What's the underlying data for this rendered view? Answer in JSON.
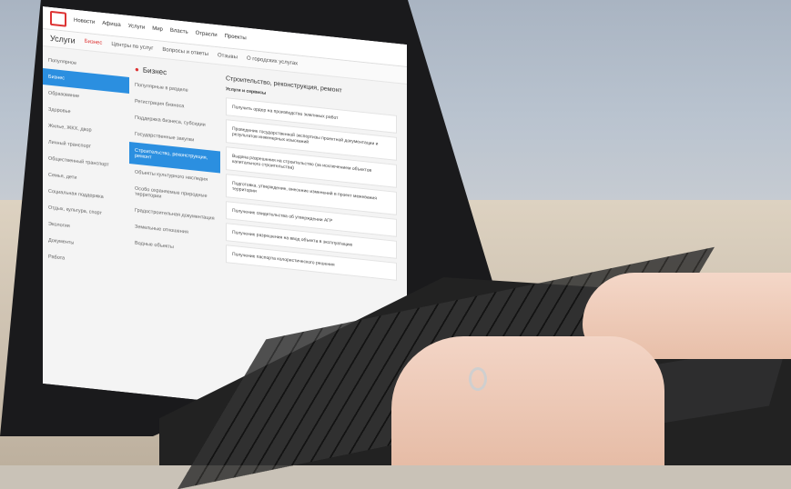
{
  "screen": {
    "topnav": [
      "Новости",
      "Афиша",
      "Услуги",
      "Мир",
      "Власть",
      "Отрасли",
      "Проекты"
    ],
    "subnav": {
      "title": "Услуги",
      "items": [
        "Бизнес",
        "Центры по услуг",
        "Вопросы и ответы",
        "Отзывы",
        "О городских услугах"
      ]
    },
    "col1": {
      "items": [
        "Популярное",
        "Бизнес",
        "Образование",
        "Здоровье",
        "Жилье, ЖКХ, двор",
        "Личный транспорт",
        "Общественный транспорт",
        "Семья, дети",
        "Социальная поддержка",
        "Отдых, культура, спорт",
        "Экология",
        "Документы",
        "Работа"
      ]
    },
    "col2": {
      "title": "Бизнес",
      "items": [
        "Популярные в разделе",
        "Регистрация бизнеса",
        "Поддержка бизнеса, субсидии",
        "Государственные закупки",
        "Строительство, реконструкция, ремонт",
        "Объекты культурного наследия",
        "Особо охраняемые природные территории",
        "Градостроительная документация",
        "Земельные отношения",
        "Водные объекты"
      ]
    },
    "col3": {
      "title": "Строительство, реконструкция, ремонт",
      "subtitle": "Услуги и сервисы",
      "cards": [
        "Получить ордер на производство земляных работ",
        "Проведение государственной экспертизы проектной документации и результатов инженерных изысканий",
        "Выдача разрешения на строительство (за исключением объектов капитального строительства)",
        "Подготовка, утверждение, внесение изменений в проект межевания территории",
        "Получение свидетельства об утверждении АГР",
        "Получение разрешения на ввод объекта в эксплуатацию",
        "Получение паспорта колористического решения"
      ]
    }
  },
  "colors": {
    "accent": "#2b8fe0",
    "brand": "#dd3333"
  }
}
